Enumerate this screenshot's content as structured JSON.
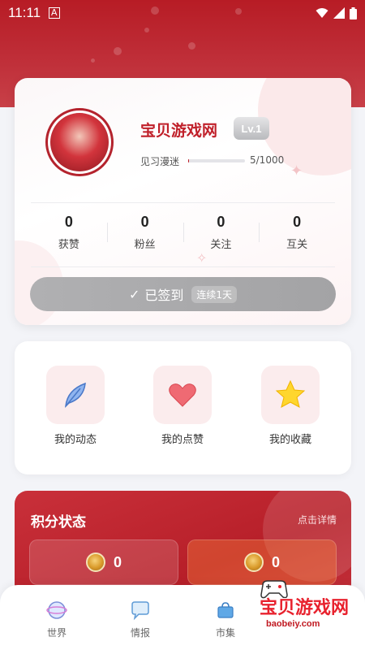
{
  "status_bar": {
    "time": "11:11",
    "notification_glyph": "A"
  },
  "profile": {
    "username": "宝贝游戏网",
    "level": "Lv.1",
    "rank": "见习漫迷",
    "progress_text": "5/1000",
    "progress_fraction": 0.005,
    "stats": [
      {
        "value": "0",
        "label": "获赞"
      },
      {
        "value": "0",
        "label": "粉丝"
      },
      {
        "value": "0",
        "label": "关注"
      },
      {
        "value": "0",
        "label": "互关"
      }
    ],
    "checkin": {
      "label": "已签到",
      "streak": "连续1天"
    }
  },
  "actions": [
    {
      "label": "我的动态",
      "icon": "feather-icon"
    },
    {
      "label": "我的点赞",
      "icon": "heart-icon"
    },
    {
      "label": "我的收藏",
      "icon": "star-icon"
    }
  ],
  "points": {
    "title": "积分状态",
    "detail_link": "点击详情",
    "values": [
      "0",
      "0"
    ]
  },
  "nav": [
    {
      "label": "世界",
      "icon": "world-icon"
    },
    {
      "label": "情报",
      "icon": "chat-icon"
    },
    {
      "label": "市集",
      "icon": "shop-icon"
    }
  ],
  "watermark": {
    "text": "宝贝游戏网",
    "url": "baobeiy.com"
  },
  "colors": {
    "brand_red": "#c0202a",
    "header_red": "#b71c25",
    "checked_gray": "#a8a8aa"
  }
}
